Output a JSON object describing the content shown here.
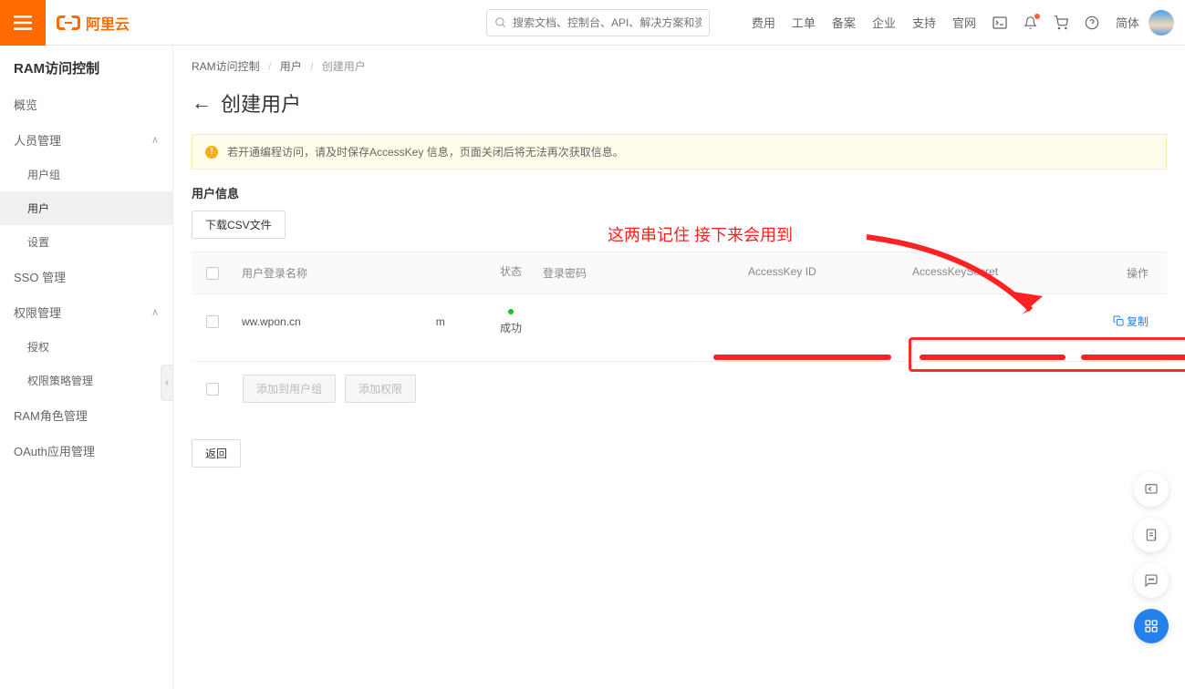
{
  "header": {
    "logo_text": "阿里云",
    "search_placeholder": "搜索文档、控制台、API、解决方案和资源",
    "nav": [
      "费用",
      "工单",
      "备案",
      "企业",
      "支持",
      "官网"
    ],
    "lang": "简体"
  },
  "sidebar": {
    "title": "RAM访问控制",
    "items": [
      {
        "label": "概览",
        "sub": false,
        "expandable": false
      },
      {
        "label": "人员管理",
        "sub": false,
        "expandable": true
      },
      {
        "label": "用户组",
        "sub": true,
        "expandable": false
      },
      {
        "label": "用户",
        "sub": true,
        "expandable": false,
        "active": true
      },
      {
        "label": "设置",
        "sub": true,
        "expandable": false
      },
      {
        "label": "SSO 管理",
        "sub": false,
        "expandable": false
      },
      {
        "label": "权限管理",
        "sub": false,
        "expandable": true
      },
      {
        "label": "授权",
        "sub": true,
        "expandable": false
      },
      {
        "label": "权限策略管理",
        "sub": true,
        "expandable": false
      },
      {
        "label": "RAM角色管理",
        "sub": false,
        "expandable": false
      },
      {
        "label": "OAuth应用管理",
        "sub": false,
        "expandable": false
      }
    ]
  },
  "breadcrumb": {
    "level1": "RAM访问控制",
    "level2": "用户",
    "level3": "创建用户"
  },
  "page": {
    "title": "创建用户",
    "alert": "若开通编程访问，请及时保存AccessKey 信息，页面关闭后将无法再次获取信息。",
    "section_title": "用户信息",
    "download_btn": "下载CSV文件",
    "back_btn": "返回"
  },
  "table": {
    "headers": {
      "name": "用户登录名称",
      "status": "状态",
      "password": "登录密码",
      "akid": "AccessKey ID",
      "aksec": "AccessKeySecret",
      "op": "操作"
    },
    "row": {
      "name_visible": "ww.wpon.cn",
      "name_tail": "m",
      "status": "成功",
      "copy": "复制"
    }
  },
  "actions": {
    "add_to_group": "添加到用户组",
    "add_perm": "添加权限"
  },
  "annotation": {
    "text": "这两串记住 接下来会用到"
  }
}
